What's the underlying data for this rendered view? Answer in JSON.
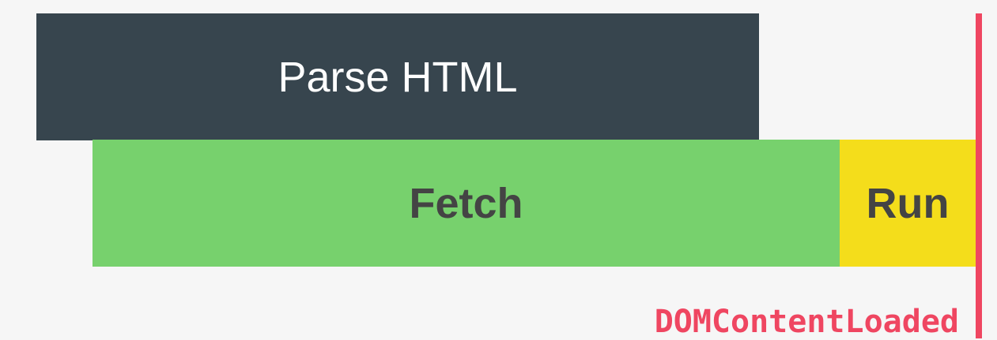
{
  "bars": {
    "parse": {
      "label": "Parse HTML",
      "color": "#37454e",
      "text_color": "#ffffff"
    },
    "fetch": {
      "label": "Fetch",
      "color": "#77d16d",
      "text_color": "#444444"
    },
    "run": {
      "label": "Run",
      "color": "#f4dd1b",
      "text_color": "#444444"
    }
  },
  "marker": {
    "label": "DOMContentLoaded",
    "color": "#ef4661"
  }
}
